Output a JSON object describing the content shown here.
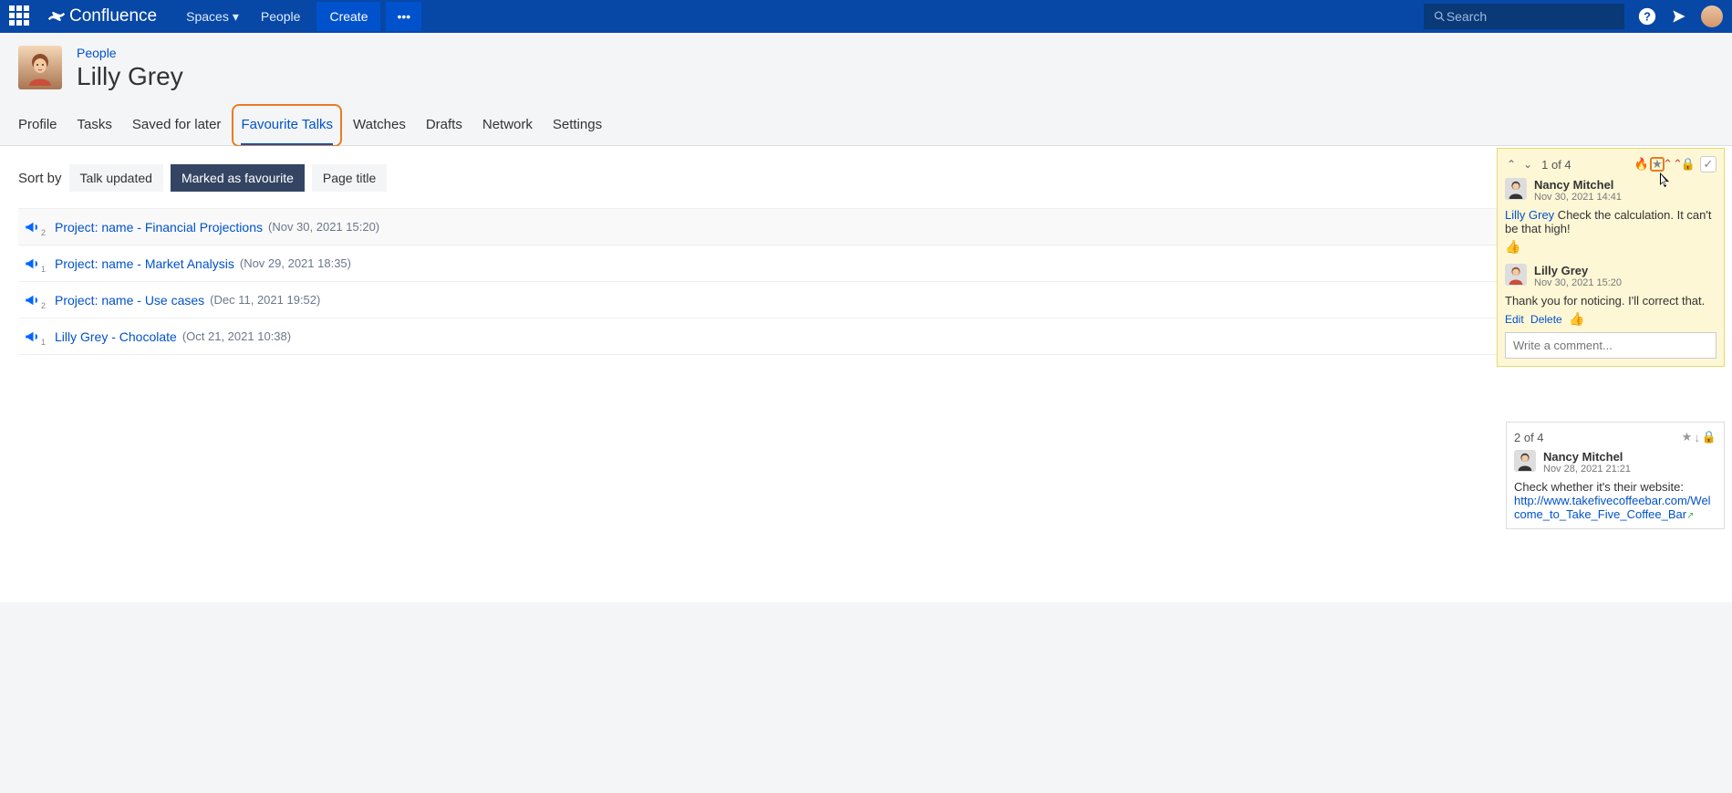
{
  "topbar": {
    "logo": "Confluence",
    "nav": {
      "spaces": "Spaces",
      "people": "People",
      "create": "Create"
    },
    "search_placeholder": "Search"
  },
  "header": {
    "breadcrumb": "People",
    "title": "Lilly Grey"
  },
  "tabs": {
    "profile": "Profile",
    "tasks": "Tasks",
    "saved": "Saved for later",
    "fav": "Favourite Talks",
    "watches": "Watches",
    "drafts": "Drafts",
    "network": "Network",
    "settings": "Settings"
  },
  "sort": {
    "label": "Sort by",
    "talk_updated": "Talk updated",
    "marked": "Marked as favourite",
    "page_title": "Page title"
  },
  "talks": [
    {
      "badge": "2",
      "title": "Project: name - Financial Projections",
      "date": "(Nov 30, 2021 15:20)"
    },
    {
      "badge": "1",
      "title": "Project: name - Market Analysis",
      "date": "(Nov 29, 2021 18:35)"
    },
    {
      "badge": "2",
      "title": "Project: name - Use cases",
      "date": "(Dec 11, 2021 19:52)"
    },
    {
      "badge": "1",
      "title": "Lilly Grey - Chocolate",
      "date": "(Oct 21, 2021 10:38)"
    }
  ],
  "popover": {
    "count": "1 of 4",
    "c1": {
      "name": "Nancy Mitchel",
      "ts": "Nov 30, 2021 14:41",
      "mention": "Lilly Grey",
      "text": " Check the calculation. It can't be that high!"
    },
    "c2": {
      "name": "Lilly Grey",
      "ts": "Nov 30, 2021 15:20",
      "text": "Thank you for noticing. I'll correct that.",
      "edit": "Edit",
      "delete": "Delete"
    },
    "reply_placeholder": "Write a comment..."
  },
  "card2": {
    "count": "2 of 4",
    "name": "Nancy Mitchel",
    "ts": "Nov 28, 2021 21:21",
    "text": "Check whether it's their website:",
    "link": "http://www.takefivecoffeebar.com/Welcome_to_Take_Five_Coffee_Bar"
  }
}
